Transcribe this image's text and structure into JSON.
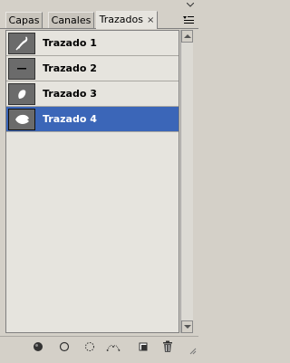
{
  "tabs": [
    {
      "label": "Capas",
      "active": false
    },
    {
      "label": "Canales",
      "active": false
    },
    {
      "label": "Trazados",
      "active": true,
      "close": "×"
    }
  ],
  "paths": [
    {
      "name": "Trazado 1",
      "icon": "path-shape-icon",
      "selected": false
    },
    {
      "name": "Trazado 2",
      "icon": "path-line-icon",
      "selected": false
    },
    {
      "name": "Trazado 3",
      "icon": "path-blob-icon",
      "selected": false
    },
    {
      "name": "Trazado 4",
      "icon": "path-fish-icon",
      "selected": true
    }
  ],
  "toolbar": {
    "fill_path": "fill-path-icon",
    "stroke_path": "stroke-path-icon",
    "load_selection": "load-selection-icon",
    "make_work_path": "make-work-path-icon",
    "new_path": "new-path-icon",
    "delete_path": "trash-icon"
  },
  "colors": {
    "selection": "#3b66b8",
    "list_bg": "#e6e4de",
    "panel_bg": "#d4d0c8"
  }
}
